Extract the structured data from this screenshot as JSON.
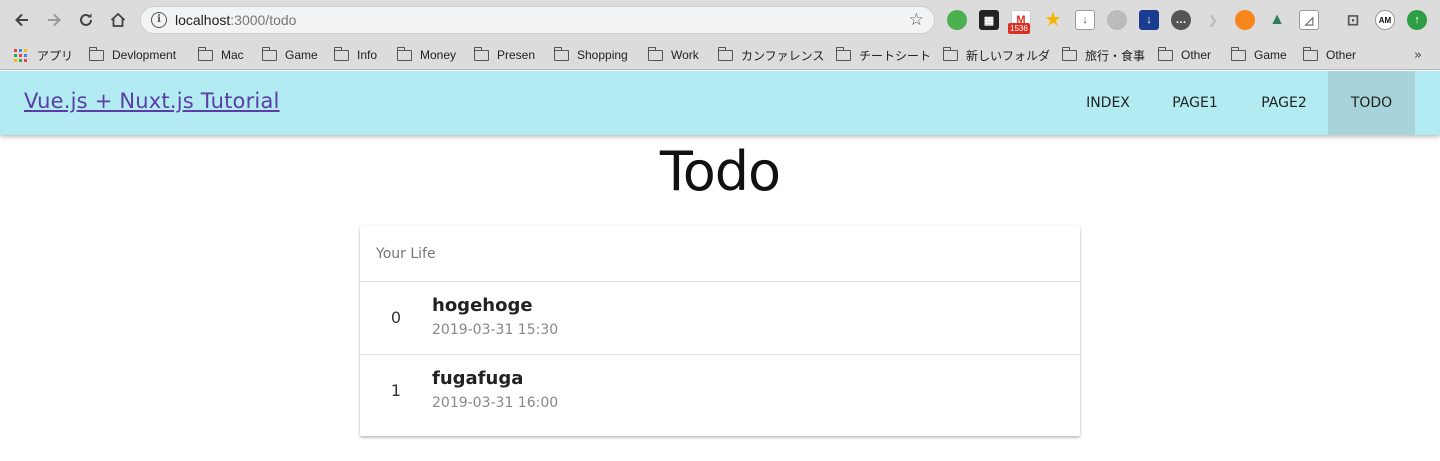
{
  "browser": {
    "url_host": "localhost",
    "url_path": ":3000/todo",
    "gmail_badge": "1536",
    "ext_am_label": "AM",
    "bookmarks": [
      {
        "label": "アプリ",
        "type": "apps"
      },
      {
        "label": "Devlopment",
        "type": "folder"
      },
      {
        "label": "Mac",
        "type": "folder"
      },
      {
        "label": "Game",
        "type": "folder"
      },
      {
        "label": "Info",
        "type": "folder"
      },
      {
        "label": "Money",
        "type": "folder"
      },
      {
        "label": "Presen",
        "type": "folder"
      },
      {
        "label": "Shopping",
        "type": "folder"
      },
      {
        "label": "Work",
        "type": "folder"
      },
      {
        "label": "カンファレンス",
        "type": "folder"
      },
      {
        "label": "チートシート",
        "type": "folder"
      },
      {
        "label": "新しいフォルダ",
        "type": "folder"
      },
      {
        "label": "旅行・食事",
        "type": "folder"
      },
      {
        "label": "Other",
        "type": "folder"
      },
      {
        "label": "Game",
        "type": "folder"
      },
      {
        "label": "Other",
        "type": "folder"
      }
    ],
    "more_label": "»"
  },
  "navbar": {
    "brand": "Vue.js + Nuxt.js Tutorial",
    "items": [
      {
        "label": "INDEX"
      },
      {
        "label": "PAGE1"
      },
      {
        "label": "PAGE2"
      },
      {
        "label": "TODO",
        "active": true
      }
    ],
    "bg_color": "#b2ebf2",
    "active_color": "#a6d4da",
    "brand_color": "#5b3ea5"
  },
  "page": {
    "title": "Todo",
    "list": {
      "subheader": "Your Life",
      "items": [
        {
          "index": "0",
          "title": "hogehoge",
          "date": "2019-03-31 15:30"
        },
        {
          "index": "1",
          "title": "fugafuga",
          "date": "2019-03-31 16:00"
        }
      ]
    }
  }
}
